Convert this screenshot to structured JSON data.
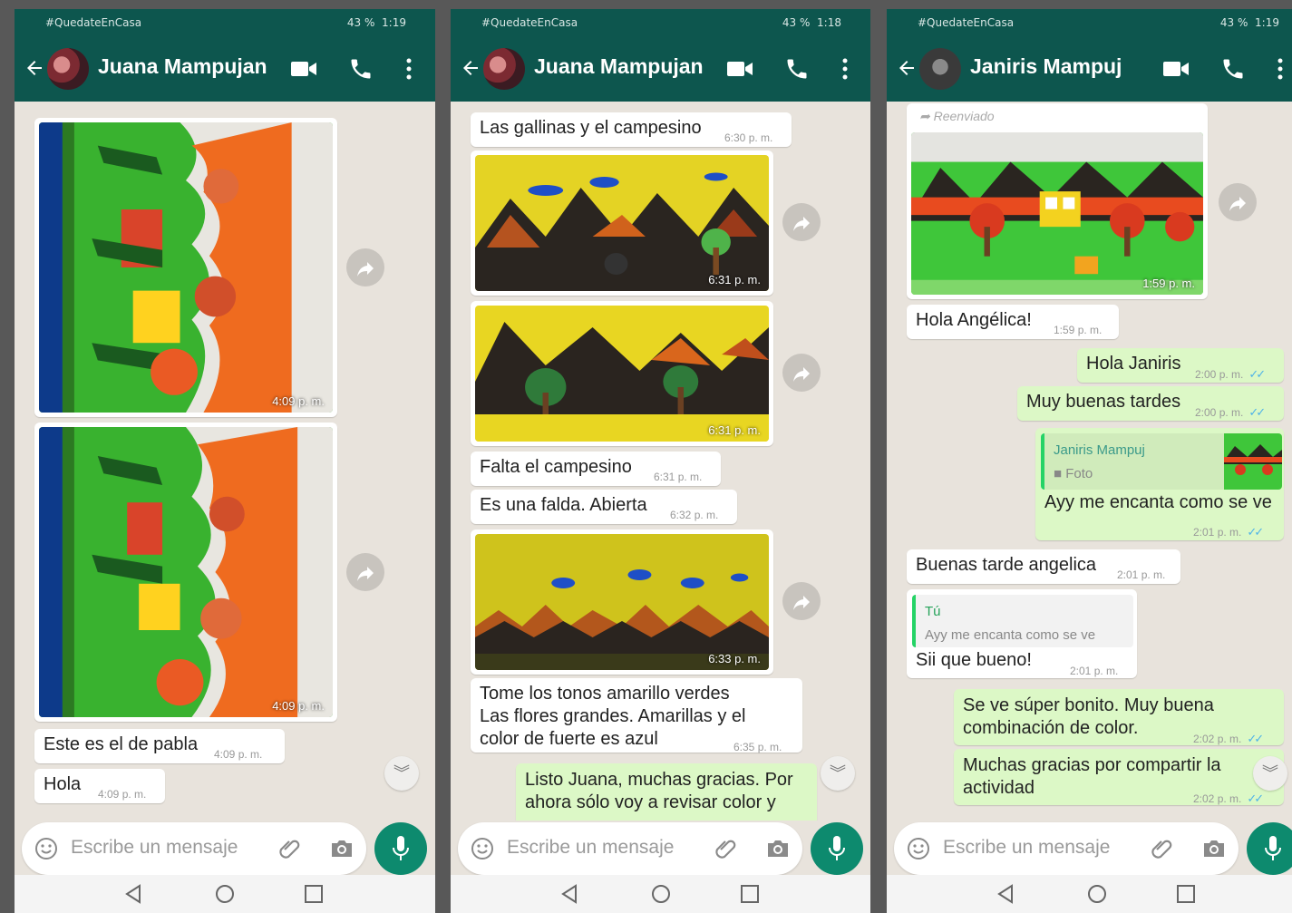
{
  "status": {
    "left": "#QuedateEnCasa",
    "battery": "43 %",
    "time_a": "1:19",
    "time_b": "1:18"
  },
  "composer": {
    "placeholder": "Escribe un mensaje"
  },
  "icons": [
    "back-arrow-icon",
    "avatar",
    "video-call-icon",
    "phone-icon",
    "menu-dots-icon",
    "forward-icon",
    "scroll-down-icon",
    "emoji-icon",
    "attach-icon",
    "camera-icon",
    "mic-icon",
    "nav-back-icon",
    "nav-home-icon",
    "nav-recents-icon"
  ],
  "colors": {
    "header": "#0d564e",
    "outgoing_bubble": "#dcf8c6",
    "read_ticks": "#4fb3e8",
    "mic_button": "#0d8a6e",
    "chat_bg": "#e8e3dc"
  },
  "phones": [
    {
      "contact": "Juana Mampujan",
      "images": [
        {
          "time": "4:09 p. m."
        },
        {
          "time": "4:09 p. m."
        }
      ],
      "messages": [
        {
          "text": "Este es el de pabla",
          "time": "4:09 p. m."
        },
        {
          "text": "Hola",
          "time": "4:09 p. m."
        }
      ]
    },
    {
      "contact": "Juana Mampujan",
      "messages": [
        {
          "text": "Las gallinas y el campesino",
          "time": "6:30 p. m."
        },
        {
          "text": "Falta el campesino",
          "time": "6:31 p. m."
        },
        {
          "text": "Es una falda. Abierta",
          "time": "6:32 p. m."
        },
        {
          "text": "Tome los tonos amarillo verdes\nLas flores grandes. Amarillas y el\ncolor de fuerte es azul",
          "time": "6:35 p. m."
        },
        {
          "text": "Listo Juana, muchas gracias. Por\nahora sólo voy a revisar color y"
        }
      ],
      "images": [
        {
          "time": "6:31 p. m."
        },
        {
          "time": "6:31 p. m."
        },
        {
          "time": "6:33 p. m."
        }
      ]
    },
    {
      "contact": "Janiris Mampuj",
      "forwarded_label": "Reenviado",
      "image": {
        "time": "1:59 p. m."
      },
      "messages": [
        {
          "text": "Hola Angélica!",
          "time": "1:59 p. m."
        },
        {
          "text": "Hola Janiris",
          "time": "2:00 p. m."
        },
        {
          "text": "Muy buenas tardes",
          "time": "2:00 p. m."
        },
        {
          "quote_author": "Janiris Mampuj",
          "quote_text": "Foto",
          "text": "Ayy me encanta como se ve",
          "time": "2:01 p. m."
        },
        {
          "text": "Buenas tarde angelica",
          "time": "2:01 p. m."
        },
        {
          "quote_author": "Tú",
          "quote_text": "Ayy me encanta como se ve",
          "text": "Sii que bueno!",
          "time": "2:01 p. m."
        },
        {
          "text": "Se ve súper bonito. Muy buena\ncombinación de color.",
          "time": "2:02 p. m."
        },
        {
          "text": "Muchas gracias por compartir la\nactividad",
          "time": "2:02 p. m."
        }
      ]
    }
  ]
}
